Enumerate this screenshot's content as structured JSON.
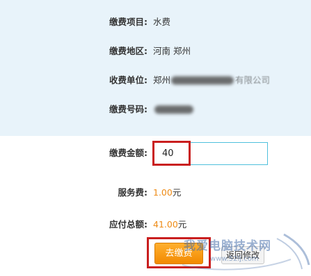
{
  "info": {
    "item_label": "缴费项目:",
    "item_value": "水费",
    "region_label": "缴费地区:",
    "region_value": "河南 郑州",
    "unit_label": "收费单位:",
    "unit_value": "郑州",
    "unit_value_tail": "有限公司",
    "number_label": "缴费号码:"
  },
  "payment": {
    "amount_label": "缴费金额:",
    "amount_value": "40",
    "service_label": "服务费:",
    "service_value": "1.00",
    "service_unit": "元",
    "total_label": "应付总额:",
    "total_value": "41.00",
    "total_unit": "元"
  },
  "actions": {
    "pay_label": "去缴费",
    "back_label": "返回修改"
  },
  "watermark": {
    "title": "我爱电脑技术网",
    "url": "www.52lj.com"
  },
  "colors": {
    "panel_bg": "#e8f3fa",
    "highlight": "#c91e1e",
    "money": "#ee8b16",
    "input_border": "#4fc0dc",
    "button": "#f28a00"
  }
}
